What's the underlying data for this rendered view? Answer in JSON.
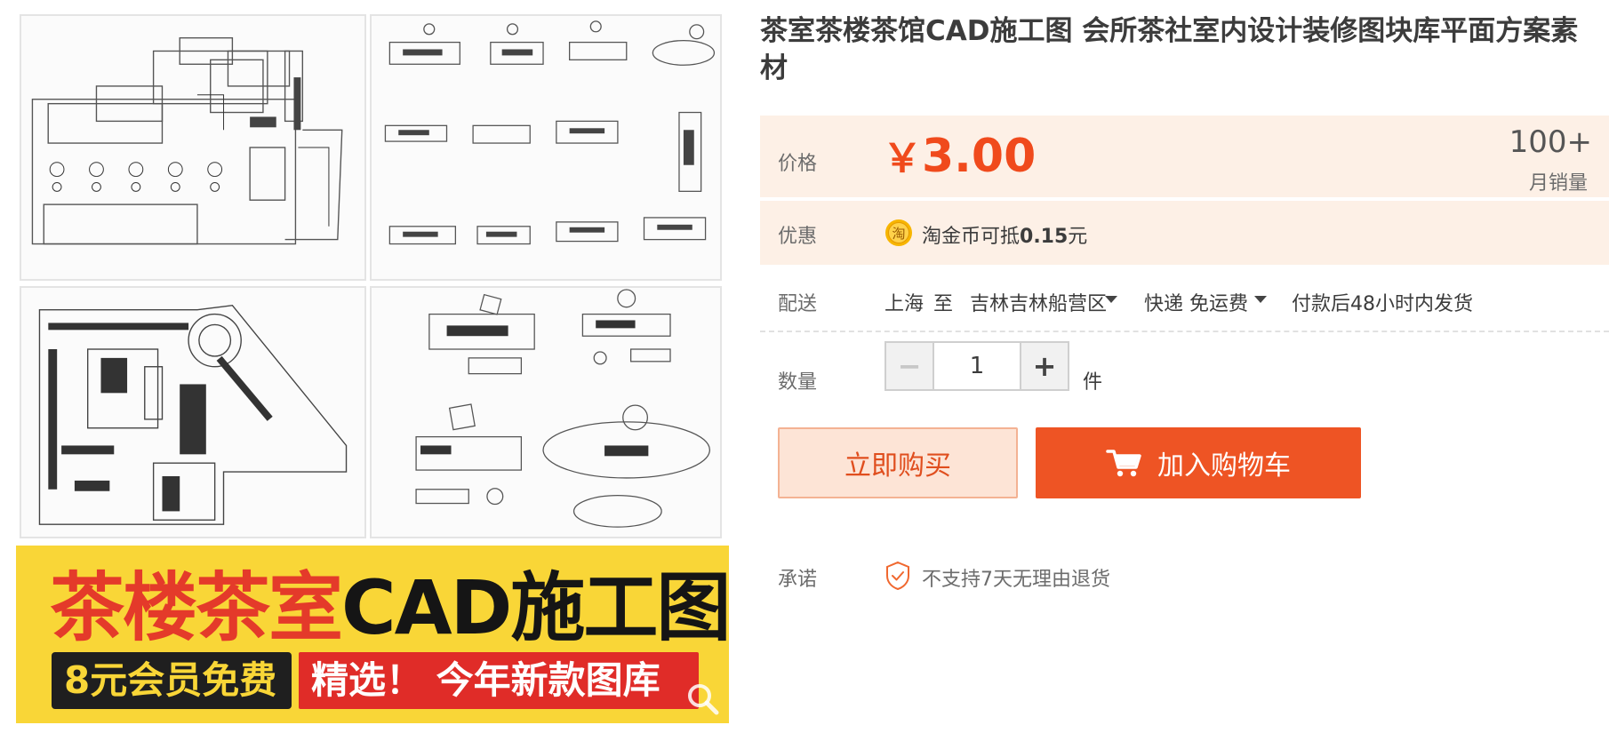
{
  "product": {
    "title": "茶室茶楼茶馆CAD施工图 会所茶社室内设计装修图块库平面方案素材"
  },
  "gallery": {
    "banner": {
      "title_red": "茶楼茶室",
      "title_black": "CAD施工图",
      "pill_member": "8元会员免费",
      "pill_select": "精选！ 今年新款图库"
    }
  },
  "price": {
    "label": "价格",
    "currency": "￥",
    "value": "3.00",
    "sales_count": "100+",
    "sales_label": "月销量"
  },
  "promo": {
    "label": "优惠",
    "coin_glyph": "淘",
    "text_prefix": "淘金币可抵",
    "amount": "0.15",
    "text_suffix": "元"
  },
  "shipping": {
    "label": "配送",
    "from": "上海",
    "to_word": "至",
    "destination": "吉林吉林船营区",
    "method": "快递 免运费",
    "dispatch": "付款后48小时内发货"
  },
  "quantity": {
    "label": "数量",
    "value": "1",
    "unit": "件",
    "minus": "−",
    "plus": "+"
  },
  "actions": {
    "buy_now": "立即购买",
    "add_to_cart": "加入购物车"
  },
  "promise": {
    "label": "承诺",
    "text": "不支持7天无理由退货"
  },
  "colors": {
    "accent": "#ee5424",
    "price": "#f04a1c",
    "banner_bg": "#f9d637",
    "banner_red": "#e43a2a"
  }
}
